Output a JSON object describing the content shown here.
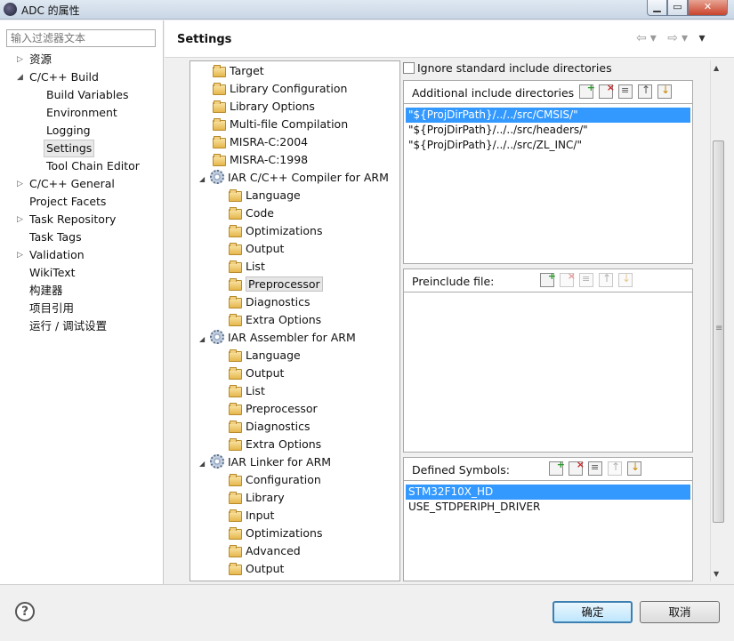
{
  "window": {
    "title": "ADC 的属性"
  },
  "left_pane": {
    "filter_placeholder": "输入过滤器文本",
    "items": [
      {
        "label": "资源",
        "expandable": true,
        "expanded": false
      },
      {
        "label": "C/C++ Build",
        "expandable": true,
        "expanded": true
      },
      {
        "label": "Build Variables"
      },
      {
        "label": "Environment"
      },
      {
        "label": "Logging"
      },
      {
        "label": "Settings",
        "selected": true
      },
      {
        "label": "Tool Chain Editor"
      },
      {
        "label": "C/C++ General",
        "expandable": true,
        "expanded": false
      },
      {
        "label": "Project Facets"
      },
      {
        "label": "Task Repository",
        "expandable": true,
        "expanded": false
      },
      {
        "label": "Task Tags"
      },
      {
        "label": "Validation",
        "expandable": true,
        "expanded": false
      },
      {
        "label": "WikiText"
      },
      {
        "label": "构建器"
      },
      {
        "label": "项目引用"
      },
      {
        "label": "运行 / 调试设置"
      }
    ]
  },
  "header": {
    "title": "Settings"
  },
  "tool_tree": {
    "items": [
      {
        "label": "Target",
        "icon": "folder-icon"
      },
      {
        "label": "Library Configuration",
        "icon": "folder-icon"
      },
      {
        "label": "Library Options",
        "icon": "folder-icon"
      },
      {
        "label": "Multi-file Compilation",
        "icon": "folder-icon"
      },
      {
        "label": "MISRA-C:2004",
        "icon": "folder-icon"
      },
      {
        "label": "MISRA-C:1998",
        "icon": "folder-icon"
      },
      {
        "label": "IAR C/C++ Compiler for ARM",
        "icon": "gear-icon"
      },
      {
        "label": "Language",
        "icon": "folder-icon"
      },
      {
        "label": "Code",
        "icon": "folder-icon"
      },
      {
        "label": "Optimizations",
        "icon": "folder-icon"
      },
      {
        "label": "Output",
        "icon": "folder-icon"
      },
      {
        "label": "List",
        "icon": "folder-icon"
      },
      {
        "label": "Preprocessor",
        "icon": "folder-icon",
        "selected": true
      },
      {
        "label": "Diagnostics",
        "icon": "folder-icon"
      },
      {
        "label": "Extra Options",
        "icon": "folder-icon"
      },
      {
        "label": "IAR Assembler for ARM",
        "icon": "gear-icon"
      },
      {
        "label": "Language",
        "icon": "folder-icon"
      },
      {
        "label": "Output",
        "icon": "folder-icon"
      },
      {
        "label": "List",
        "icon": "folder-icon"
      },
      {
        "label": "Preprocessor",
        "icon": "folder-icon"
      },
      {
        "label": "Diagnostics",
        "icon": "folder-icon"
      },
      {
        "label": "Extra Options",
        "icon": "folder-icon"
      },
      {
        "label": "IAR Linker for ARM",
        "icon": "gear-icon"
      },
      {
        "label": "Configuration",
        "icon": "folder-icon"
      },
      {
        "label": "Library",
        "icon": "folder-icon"
      },
      {
        "label": "Input",
        "icon": "folder-icon"
      },
      {
        "label": "Optimizations",
        "icon": "folder-icon"
      },
      {
        "label": "Advanced",
        "icon": "folder-icon"
      },
      {
        "label": "Output",
        "icon": "folder-icon"
      }
    ]
  },
  "options": {
    "ignore_std_include": {
      "label": "Ignore standard include directories",
      "checked": false
    },
    "include_dirs": {
      "title": "Additional include directories",
      "items": [
        "\"${ProjDirPath}/../../src/CMSIS/\"",
        "\"${ProjDirPath}/../../src/headers/\"",
        "\"${ProjDirPath}/../../src/ZL_INC/\""
      ],
      "selected_index": 0
    },
    "preinclude": {
      "title": "Preinclude file:",
      "items": []
    },
    "defined_symbols": {
      "title": "Defined Symbols:",
      "items": [
        "STM32F10X_HD",
        "USE_STDPERIPH_DRIVER"
      ],
      "selected_index": 0
    }
  },
  "buttons": {
    "ok": "确定",
    "cancel": "取消"
  }
}
